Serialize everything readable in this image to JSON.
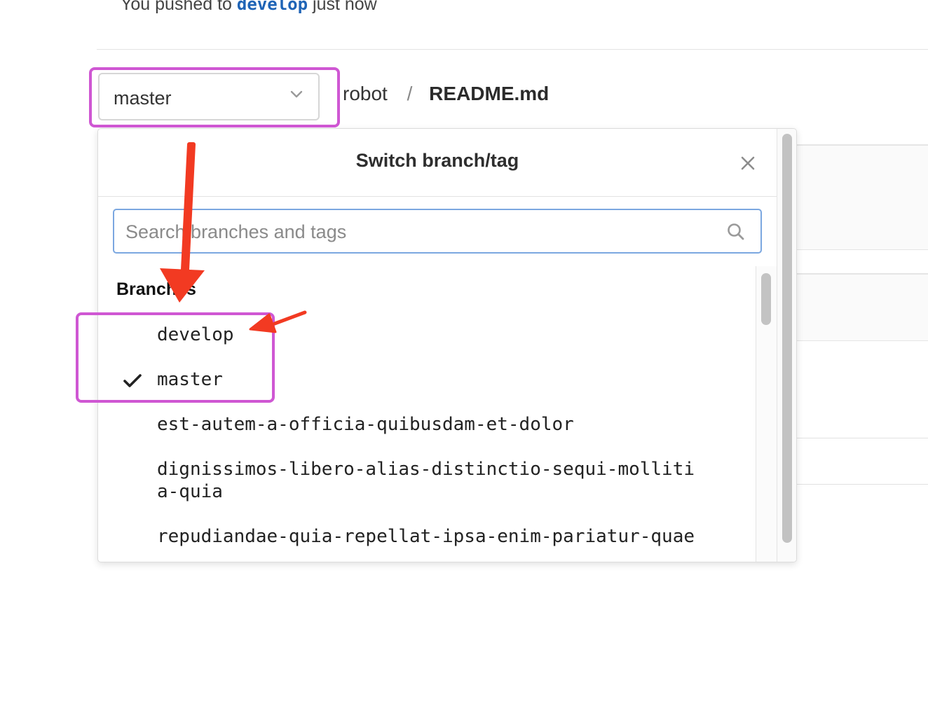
{
  "banner": {
    "prefix": "You pushed to",
    "branch": "develop",
    "suffix": "just now"
  },
  "selector": {
    "current_branch": "master"
  },
  "breadcrumb": {
    "repo": "robot",
    "separator": "/",
    "file": "README.md"
  },
  "dropdown": {
    "title": "Switch branch/tag",
    "search_placeholder": "Search branches and tags",
    "section_label": "Branches",
    "items": [
      {
        "label": "develop",
        "selected": false
      },
      {
        "label": "master",
        "selected": true
      },
      {
        "label": "est-autem-a-officia-quibusdam-et-dolor",
        "selected": false
      },
      {
        "label": "dignissimos-libero-alias-distinctio-sequi-mollitia-quia",
        "selected": false
      },
      {
        "label": "repudiandae-quia-repellat-ipsa-enim-pariatur-quae",
        "selected": false
      }
    ]
  },
  "icons": {
    "chevron": "chevron-down-icon",
    "close": "close-icon",
    "search": "search-icon",
    "check": "check-icon"
  },
  "colors": {
    "highlight": "#cf57d3",
    "arrow": "#f23a22",
    "link": "#1f64b6",
    "search_focus_border": "#7ba7e0"
  }
}
